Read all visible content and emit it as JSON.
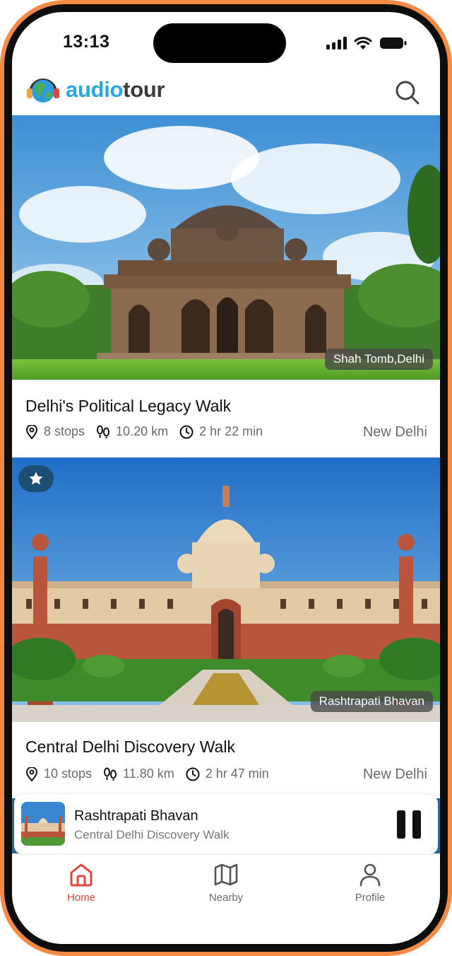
{
  "status_bar": {
    "time": "13:13"
  },
  "app": {
    "logo_part1": "audio",
    "logo_part2": "tour"
  },
  "tours": [
    {
      "title": "Delhi's Political Legacy Walk",
      "image_caption": "Shah Tomb,Delhi",
      "stops": "8 stops",
      "distance": "10.20 km",
      "duration": "2 hr 22 min",
      "city": "New Delhi",
      "favorite": false
    },
    {
      "title": "Central Delhi Discovery Walk",
      "image_caption": "Rashtrapati Bhavan",
      "stops": "10 stops",
      "distance": "11.80 km",
      "duration": "2 hr 47 min",
      "city": "New Delhi",
      "favorite": true
    }
  ],
  "player": {
    "track": "Rashtrapati Bhavan",
    "tour": "Central Delhi Discovery Walk",
    "state": "playing"
  },
  "nav": [
    {
      "label": "Home",
      "icon": "home-icon",
      "active": true
    },
    {
      "label": "Nearby",
      "icon": "map-icon",
      "active": false
    },
    {
      "label": "Profile",
      "icon": "profile-icon",
      "active": false
    }
  ],
  "colors": {
    "frame": "#F58A45",
    "brand_blue": "#2CA6DB",
    "active_nav": "#E2453C",
    "favorite_badge": "#1c4e73"
  }
}
